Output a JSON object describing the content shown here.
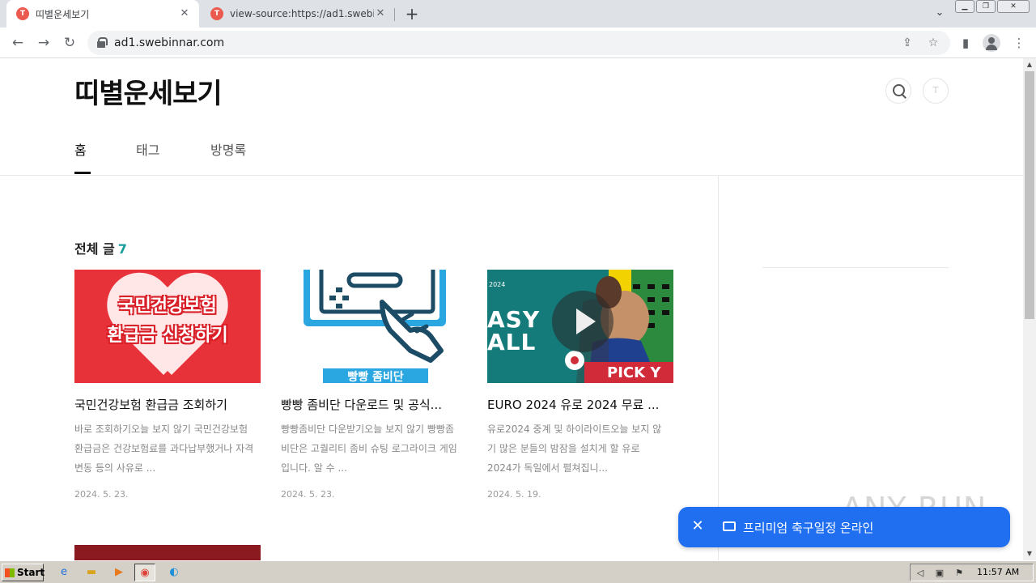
{
  "browser": {
    "tabs": [
      {
        "title": "띠별운세보기",
        "favicon": "T"
      },
      {
        "title": "view-source:https://ad1.swebinnar.",
        "favicon": "T"
      }
    ],
    "url": "ad1.swebinnar.com"
  },
  "blog": {
    "title": "띠별운세보기",
    "menu": [
      "홈",
      "태그",
      "방명록"
    ],
    "section_title": "전체 글",
    "post_count": "7",
    "posts": [
      {
        "title": "국민건강보험 환급금 조회하기",
        "desc": "바로 조회하기오늘 보지 않기 국민건강보험 환급금은 건강보험료를 과다납부했거나 자격 변동 등의 사유로 ...",
        "date": "2024. 5. 23.",
        "thumb_text_1": "국민건강보험",
        "thumb_text_2": "환급금 신청하기"
      },
      {
        "title": "빵빵 좀비단 다운로드 및 공식...",
        "desc": "빵빵좀비단 다운받기오늘 보지 않기 빵빵좀비단은 고퀄리티 좀비 슈팅 로그라이크 게임입니다. 알 수 ...",
        "date": "2024. 5. 23.",
        "thumb_text": "빵빵 좀비단"
      },
      {
        "title": "EURO 2024 유로 2024 무료 ...",
        "desc": "유로2024 중계 및 하이라이트오늘 보지 않기   많은 분들의 밤잠을 설치게 할 유로 2024가 독일에서 펼쳐집니...",
        "date": "2024. 5. 19.",
        "thumb_small": "2024",
        "thumb_text_1": "ASY",
        "thumb_text_2": "ALL",
        "thumb_pick": "PICK Y"
      }
    ]
  },
  "promo": {
    "text": "프리미엄 축구일정 온라인",
    "watermark": "ANY RUN"
  },
  "taskbar": {
    "start": "Start",
    "clock": "11:57 AM"
  },
  "colors": {
    "accent": "#1a9c9c",
    "promo": "#1f6ff0",
    "thumb1_bg": "#e8323a"
  }
}
